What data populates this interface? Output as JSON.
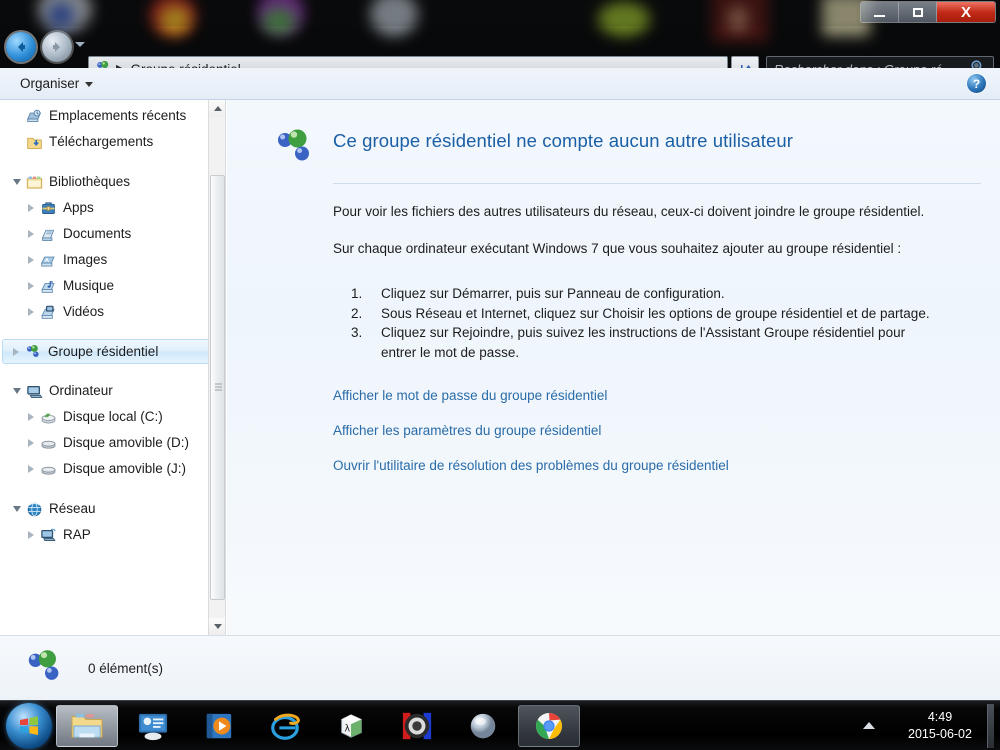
{
  "window": {
    "title": "Groupe résidentiel",
    "buttons": {
      "minimize": "–",
      "maximize": "❐",
      "close": "X"
    }
  },
  "nav": {
    "back_label": "←",
    "forward_label": "→",
    "history_label": "▾",
    "address_icon": "homegroup-icon",
    "address_separator": "▶",
    "address_value": "Groupe résidentiel",
    "refresh_label": "↻"
  },
  "search": {
    "placeholder": "Rechercher dans : Groupe ré",
    "value": "",
    "icon": "search-icon"
  },
  "toolbar": {
    "organise_label": "Organiser",
    "help_label": "?"
  },
  "sidebar": {
    "items": [
      {
        "label": "Emplacements récents",
        "icon": "recent-places-icon",
        "indent": 1,
        "arrow": "none",
        "selected": false
      },
      {
        "label": "Téléchargements",
        "icon": "downloads-folder-icon",
        "indent": 1,
        "arrow": "none",
        "selected": false
      },
      {
        "label": "Bibliothèques",
        "icon": "libraries-icon",
        "indent": 0,
        "arrow": "open",
        "selected": false
      },
      {
        "label": "Apps",
        "icon": "apps-library-icon",
        "indent": 2,
        "arrow": "closed",
        "selected": false
      },
      {
        "label": "Documents",
        "icon": "documents-library-icon",
        "indent": 2,
        "arrow": "closed",
        "selected": false
      },
      {
        "label": "Images",
        "icon": "pictures-library-icon",
        "indent": 2,
        "arrow": "closed",
        "selected": false
      },
      {
        "label": "Musique",
        "icon": "music-library-icon",
        "indent": 2,
        "arrow": "closed",
        "selected": false
      },
      {
        "label": "Vidéos",
        "icon": "videos-library-icon",
        "indent": 2,
        "arrow": "closed",
        "selected": false
      },
      {
        "label": "Groupe résidentiel",
        "icon": "homegroup-icon",
        "indent": 0,
        "arrow": "closed",
        "selected": true
      },
      {
        "label": "Ordinateur",
        "icon": "computer-icon",
        "indent": 0,
        "arrow": "open",
        "selected": false
      },
      {
        "label": "Disque local (C:)",
        "icon": "local-disk-icon",
        "indent": 2,
        "arrow": "closed",
        "selected": false
      },
      {
        "label": "Disque amovible (D:)",
        "icon": "removable-disk-icon",
        "indent": 2,
        "arrow": "closed",
        "selected": false
      },
      {
        "label": "Disque amovible (J:)",
        "icon": "removable-disk-icon",
        "indent": 2,
        "arrow": "closed",
        "selected": false
      },
      {
        "label": "Réseau",
        "icon": "network-icon",
        "indent": 0,
        "arrow": "open",
        "selected": false
      },
      {
        "label": "RAP",
        "icon": "network-computer-icon",
        "indent": 2,
        "arrow": "closed",
        "selected": false
      }
    ]
  },
  "content": {
    "heading": "Ce groupe résidentiel ne compte aucun autre utilisateur",
    "heading_icon": "homegroup-icon",
    "paragraph1": "Pour voir les fichiers des autres utilisateurs du réseau, ceux-ci doivent joindre le groupe résidentiel.",
    "paragraph2": "Sur chaque ordinateur exécutant Windows 7 que vous souhaitez ajouter au groupe résidentiel :",
    "steps": [
      {
        "num": "1.",
        "text": "Cliquez sur Démarrer, puis sur Panneau de configuration."
      },
      {
        "num": "2.",
        "text": "Sous Réseau et Internet, cliquez sur Choisir les options de groupe résidentiel et de partage."
      },
      {
        "num": "3.",
        "text": "Cliquez sur Rejoindre, puis suivez les instructions de l'Assistant Groupe résidentiel pour entrer le mot de passe."
      }
    ],
    "links": [
      "Afficher le mot de passe du groupe résidentiel",
      "Afficher les paramètres du groupe résidentiel",
      "Ouvrir l'utilitaire de résolution des problèmes du groupe résidentiel"
    ]
  },
  "status": {
    "icon": "homegroup-icon",
    "text": "0 élément(s)"
  },
  "taskbar": {
    "start_label": "start-orb",
    "items": [
      {
        "name": "windows-explorer-taskbar-icon",
        "active": true
      },
      {
        "name": "media-center-taskbar-icon",
        "active": false
      },
      {
        "name": "windows-media-player-taskbar-icon",
        "active": false
      },
      {
        "name": "internet-explorer-taskbar-icon",
        "active": false
      },
      {
        "name": "xnview-taskbar-icon",
        "active": false
      },
      {
        "name": "utorrent-taskbar-icon",
        "active": false
      },
      {
        "name": "orb-app-taskbar-icon",
        "active": false
      },
      {
        "name": "google-chrome-taskbar-icon",
        "active": false
      }
    ],
    "tray": {
      "show_hidden_label": "▲",
      "time": "4:49",
      "date": "2015-06-02"
    }
  },
  "colors": {
    "accent_link": "#2a6ba8",
    "heading": "#1b5fa6",
    "selection_bg": "#dff0fc",
    "close_button": "#c02a16",
    "taskbar_bg": "#000000",
    "content_bg": "#eef5fc"
  }
}
